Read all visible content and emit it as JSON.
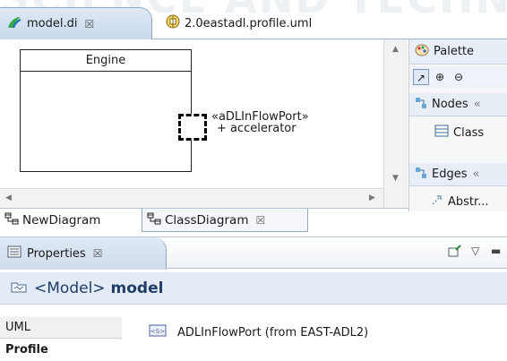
{
  "watermark": {
    "text": "SCIENCE AND TECHNOLOGY"
  },
  "editor_tabs": [
    {
      "label": "model.di",
      "close": "☒",
      "icon": "papyrus-diagram-icon",
      "active": true
    },
    {
      "label": "2.0eastadl.profile.uml",
      "icon": "uml-model-icon",
      "active": false
    }
  ],
  "diagram": {
    "class_name": "Engine",
    "port": {
      "stereotype": "«aDLInFlowPort»",
      "name": "+ accelerator"
    }
  },
  "palette": {
    "title": "Palette",
    "tools": [
      "select-icon",
      "zoom-in-icon",
      "zoom-out-icon"
    ],
    "drawers": [
      {
        "label": "Nodes",
        "collapse": "«",
        "items": [
          {
            "label": "Class",
            "icon": "class-icon"
          }
        ]
      },
      {
        "label": "Edges",
        "collapse": "«",
        "items": [
          {
            "label": "Abstr...",
            "icon": "abstraction-icon"
          }
        ]
      }
    ]
  },
  "diagram_tabs": [
    {
      "label": "NewDiagram",
      "icon": "class-diagram-icon",
      "active": false
    },
    {
      "label": "ClassDiagram",
      "icon": "class-diagram-icon",
      "close": "☒",
      "active": true
    }
  ],
  "properties": {
    "tab_label": "Properties",
    "close": "☒",
    "title_prefix": "<Model>",
    "title_name": "model",
    "sections": [
      "UML",
      "Profile"
    ],
    "applied_stereotype": "ADLInFlowPort (from EAST-ADL2)"
  },
  "colors": {
    "tab_active": "#c8d8ec",
    "title_bar": "#e3ecf6",
    "title_text": "#1f3d66"
  }
}
